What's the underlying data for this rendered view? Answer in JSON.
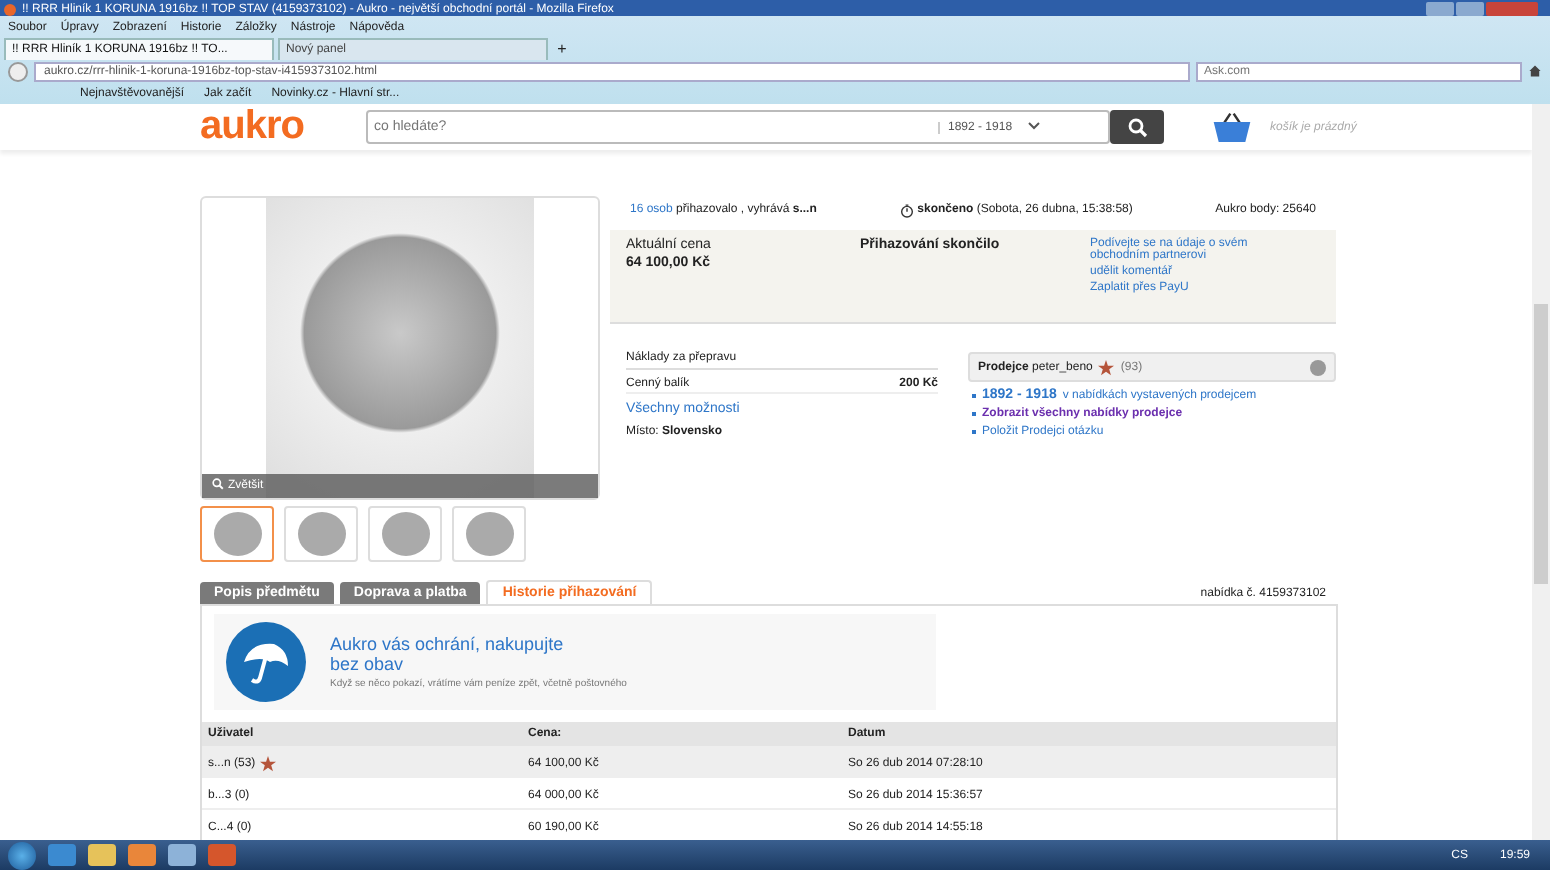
{
  "window": {
    "title": "!! RRR Hliník 1 KORUNA 1916bz !! TOP STAV (4159373102) - Aukro - největší obchodní portál - Mozilla Firefox"
  },
  "menu": [
    "Soubor",
    "Úpravy",
    "Zobrazení",
    "Historie",
    "Záložky",
    "Nástroje",
    "Nápověda"
  ],
  "browser_tabs": [
    {
      "label": "!! RRR Hliník 1 KORUNA 1916bz !! TO...",
      "selected": true
    },
    {
      "label": "Nový panel",
      "selected": false
    }
  ],
  "new_tab": "+",
  "url": "aukro.cz/rrr-hlinik-1-koruna-1916bz-top-stav-i4159373102.html",
  "search_engine": {
    "placeholder": "Ask.com"
  },
  "bookmarks": [
    "Nejnavštěvovanější",
    "Jak začít",
    "Novinky.cz - Hlavní str..."
  ],
  "header": {
    "logo": "aukro",
    "search": {
      "placeholder": "co hledáte?"
    },
    "category": "1892 - 1918",
    "cart": "košík je prázdný"
  },
  "gallery": {
    "zoom": "Zvětšit",
    "thumbnails": [
      {
        "selected": true
      },
      {
        "selected": false
      },
      {
        "selected": false
      },
      {
        "selected": false
      }
    ]
  },
  "auction": {
    "bidders": "16 osob",
    "bidders_text": "přihazovalo , vyhrává",
    "winner": "s...n",
    "ended": "skončeno",
    "ended_date": "(Sobota, 26 dubna, 15:38:58)",
    "points": "Aukro body: 25640"
  },
  "price": {
    "label": "Aktuální cena",
    "value": "64 100,00 Kč",
    "status": "Přihazování skončilo",
    "links": [
      "Podívejte se na údaje o svém obchodním partnerovi",
      "udělit komentář",
      "Zaplatit přes PayU"
    ]
  },
  "shipping": {
    "title": "Náklady za přepravu",
    "rows": [
      {
        "name": "Cenný balík",
        "price": "200 Kč"
      }
    ],
    "link": "Všechny možnosti",
    "location_label": "Místo:",
    "location": "Slovensko"
  },
  "seller": {
    "label": "Prodejce",
    "name": "peter_beno",
    "rating": "(93)",
    "links": [
      {
        "kind": "range",
        "link": "1892 - 1918",
        "text": "v nabídkách vystavených prodejcem"
      },
      {
        "kind": "strong",
        "link": "Zobrazit všechny nabídky prodejce"
      },
      {
        "kind": "plain",
        "link": "Položit Prodejci otázku"
      }
    ]
  },
  "tabs": [
    {
      "label": "Popis předmětu",
      "selected": false
    },
    {
      "label": "Doprava a platba",
      "selected": false
    },
    {
      "label": "Historie přihazování",
      "selected": true
    }
  ],
  "offer_number": "nabídka č. 4159373102",
  "protection": {
    "title": "Aukro vás ochrání, nakupujte bez obav",
    "text": "Když se něco pokazí, vrátíme vám peníze zpět, včetně poštovného"
  },
  "bids": {
    "columns": [
      "Uživatel",
      "Cena:",
      "Datum"
    ],
    "rows": [
      {
        "user": "s...n (53)",
        "star": true,
        "price": "64 100,00 Kč",
        "date": "So 26 dub 2014 07:28:10",
        "highlighted": true
      },
      {
        "user": "b...3 (0)",
        "star": false,
        "price": "64 000,00 Kč",
        "date": "So 26 dub 2014 15:36:57",
        "highlighted": false
      },
      {
        "user": "C...4 (0)",
        "star": false,
        "price": "60 190,00 Kč",
        "date": "So 26 dub 2014 14:55:18",
        "highlighted": false
      }
    ]
  },
  "taskbar": {
    "language": "CS",
    "clock": "19:59"
  }
}
